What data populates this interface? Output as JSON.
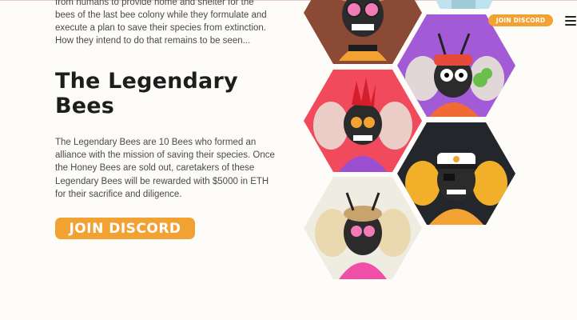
{
  "intro": {
    "text": "from humans to provide home and shelter for the bees of the last bee colony while they formulate and execute a plan to save their species from extinction. How they intend to do that remains to be seen..."
  },
  "section": {
    "title_line1": "The Legendary",
    "title_line2": "Bees",
    "body": "The Legendary Bees are 10 Bees who formed an alliance with the mission of saving their species. Once the Honey Bees are sold out, caretakers of these Legendary Bees will be rewarded with $5000 in ETH for their sacrifice and diligence.",
    "cta_label": "JOIN DISCORD"
  },
  "nav": {
    "join_label": "JOIN DISCORD",
    "menu_icon": "hamburger-menu-icon"
  },
  "colors": {
    "accent": "#f2a233",
    "heading": "#1d1d1d",
    "body_text": "#4a4a4a",
    "background": "#fdfcf8"
  },
  "gallery": {
    "images": [
      {
        "name": "bee-cowboy-pink-glasses",
        "bg": "#8a4a36"
      },
      {
        "name": "bee-bandana-smoke",
        "bg": "#a35ad6"
      },
      {
        "name": "bee-red-mohawk",
        "bg": "#f04a5c"
      },
      {
        "name": "bee-captain",
        "bg": "#23272c"
      },
      {
        "name": "bee-pink-hoodie",
        "bg": "#efece2"
      }
    ]
  }
}
